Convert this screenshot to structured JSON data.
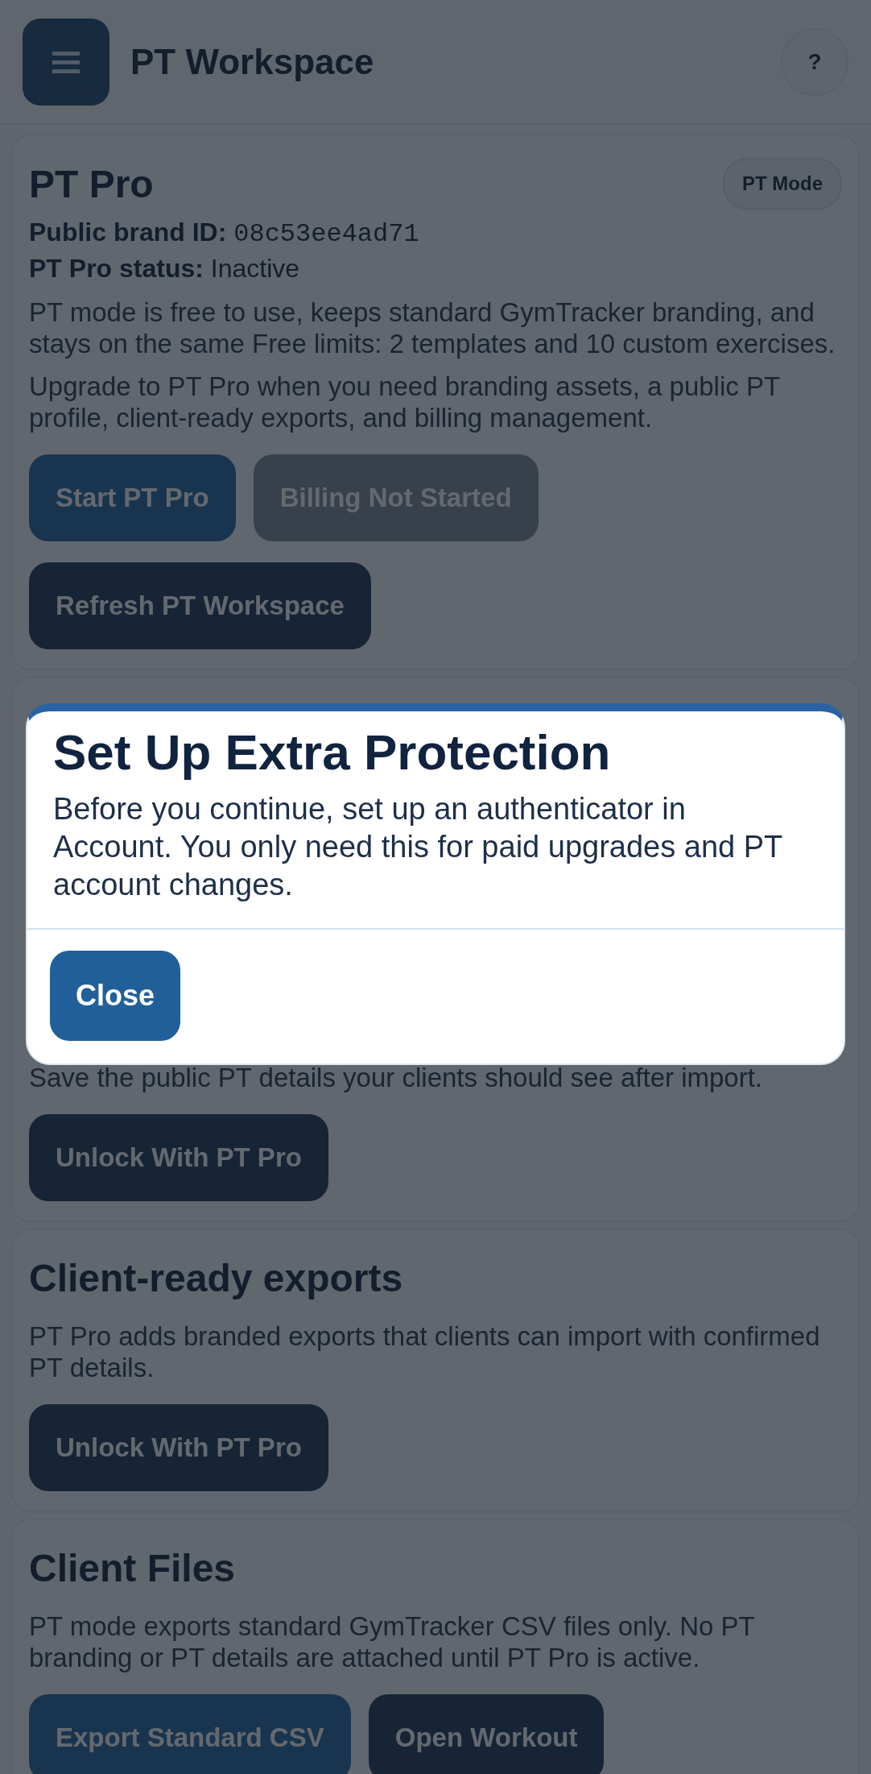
{
  "header": {
    "title": "PT Workspace",
    "help": "?"
  },
  "sections": [
    {
      "title": "PT Pro",
      "badge": "PT Mode",
      "facts": [
        {
          "label": "Public brand ID:",
          "value": "08c53ee4ad71",
          "mono": true
        },
        {
          "label": "PT Pro status:",
          "value": "Inactive",
          "mono": false
        }
      ],
      "paragraphs": [
        "PT mode is free to use, keeps standard GymTracker branding, and stays on the same Free limits: 2 templates and 10 custom exercises.",
        "Upgrade to PT Pro when you need branding assets, a public PT profile, client-ready exports, and billing management."
      ],
      "buttons": [
        {
          "label": "Start PT Pro",
          "kind": "primary"
        },
        {
          "label": "Billing Not Started",
          "kind": "secondary"
        },
        {
          "label": "Refresh PT Workspace",
          "kind": "dark"
        }
      ]
    },
    {
      "paragraphs": [
        "Save the public PT details your clients should see after import."
      ],
      "buttons": [
        {
          "label": "Unlock With PT Pro",
          "kind": "dark"
        }
      ]
    },
    {
      "title": "Client-ready exports",
      "paragraphs": [
        "PT Pro adds branded exports that clients can import with confirmed PT details."
      ],
      "buttons": [
        {
          "label": "Unlock With PT Pro",
          "kind": "dark"
        }
      ]
    },
    {
      "title": "Client Files",
      "paragraphs": [
        "PT mode exports standard GymTracker CSV files only. No PT branding or PT details are attached until PT Pro is active."
      ],
      "buttons": [
        {
          "label": "Export Standard CSV",
          "kind": "primary"
        },
        {
          "label": "Open Workout",
          "kind": "dark"
        }
      ]
    }
  ],
  "modal": {
    "title": "Set Up Extra Protection",
    "body": "Before you continue, set up an authenticator in Account. You only need this for paid upgrades and PT account changes.",
    "button": "Close"
  }
}
